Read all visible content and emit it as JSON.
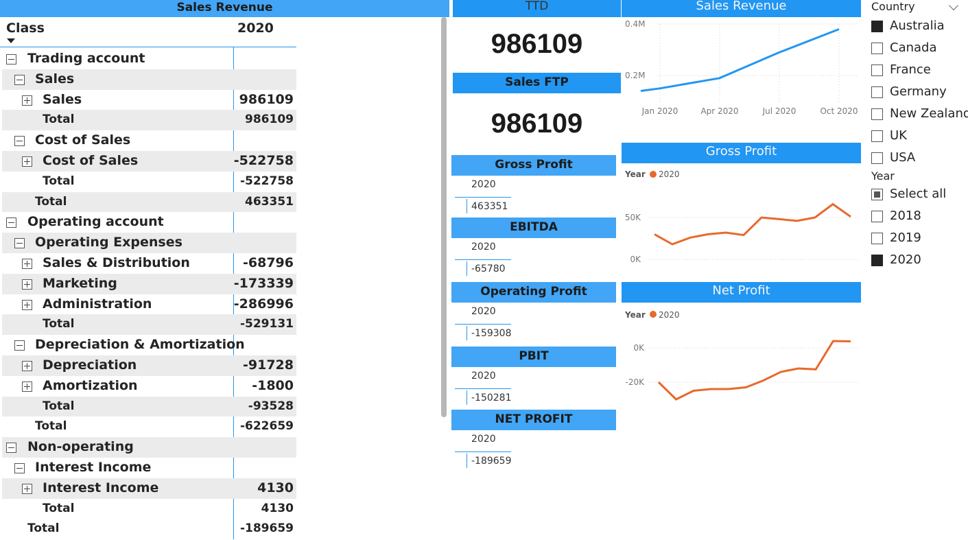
{
  "matrix": {
    "title": "Sales Revenue",
    "header_class": "Class",
    "header_year": "2020",
    "rows": [
      {
        "label": "Trading account",
        "value": "",
        "level": 0,
        "toggle": "minus",
        "shade": false,
        "total": false
      },
      {
        "label": "Sales",
        "value": "",
        "level": 1,
        "toggle": "minus",
        "shade": true,
        "total": false
      },
      {
        "label": "Sales",
        "value": "986109",
        "level": 2,
        "toggle": "plus",
        "shade": false,
        "total": false
      },
      {
        "label": "Total",
        "value": "986109",
        "level": 2,
        "toggle": "",
        "shade": true,
        "total": true
      },
      {
        "label": "Cost of Sales",
        "value": "",
        "level": 1,
        "toggle": "minus",
        "shade": false,
        "total": false
      },
      {
        "label": "Cost of Sales",
        "value": "-522758",
        "level": 2,
        "toggle": "plus",
        "shade": true,
        "total": false
      },
      {
        "label": "Total",
        "value": "-522758",
        "level": 2,
        "toggle": "",
        "shade": false,
        "total": true
      },
      {
        "label": "Total",
        "value": "463351",
        "level": 1,
        "toggle": "",
        "shade": true,
        "total": true
      },
      {
        "label": "Operating account",
        "value": "",
        "level": 0,
        "toggle": "minus",
        "shade": false,
        "total": false
      },
      {
        "label": "Operating Expenses",
        "value": "",
        "level": 1,
        "toggle": "minus",
        "shade": true,
        "total": false
      },
      {
        "label": "Sales & Distribution",
        "value": "-68796",
        "level": 2,
        "toggle": "plus",
        "shade": false,
        "total": false
      },
      {
        "label": "Marketing",
        "value": "-173339",
        "level": 2,
        "toggle": "plus",
        "shade": true,
        "total": false
      },
      {
        "label": "Administration",
        "value": "-286996",
        "level": 2,
        "toggle": "plus",
        "shade": false,
        "total": false
      },
      {
        "label": "Total",
        "value": "-529131",
        "level": 2,
        "toggle": "",
        "shade": true,
        "total": true
      },
      {
        "label": "Depreciation & Amortization",
        "value": "",
        "level": 1,
        "toggle": "minus",
        "shade": false,
        "total": false
      },
      {
        "label": "Depreciation",
        "value": "-91728",
        "level": 2,
        "toggle": "plus",
        "shade": true,
        "total": false
      },
      {
        "label": "Amortization",
        "value": "-1800",
        "level": 2,
        "toggle": "plus",
        "shade": false,
        "total": false
      },
      {
        "label": "Total",
        "value": "-93528",
        "level": 2,
        "toggle": "",
        "shade": true,
        "total": true
      },
      {
        "label": "Total",
        "value": "-622659",
        "level": 1,
        "toggle": "",
        "shade": false,
        "total": true
      },
      {
        "label": "Non-operating",
        "value": "",
        "level": 0,
        "toggle": "minus",
        "shade": true,
        "total": false
      },
      {
        "label": "Interest Income",
        "value": "",
        "level": 1,
        "toggle": "minus",
        "shade": false,
        "total": false
      },
      {
        "label": "Interest Income",
        "value": "4130",
        "level": 2,
        "toggle": "plus",
        "shade": true,
        "total": false
      },
      {
        "label": "Total",
        "value": "4130",
        "level": 2,
        "toggle": "",
        "shade": false,
        "total": true
      },
      {
        "label": "Total",
        "value": "-189659",
        "level": 0,
        "toggle": "",
        "shade": false,
        "total": true
      }
    ]
  },
  "kpis": {
    "ttd_title": "TTD",
    "ttd_value": "986109",
    "ftp_title": "Sales FTP",
    "ftp_value": "986109"
  },
  "cards": [
    {
      "title": "Gross Profit",
      "year": "2020",
      "value": "463351"
    },
    {
      "title": "EBITDA",
      "year": "2020",
      "value": "-65780"
    },
    {
      "title": "Operating Profit",
      "year": "2020",
      "value": "-159308"
    },
    {
      "title": "PBIT",
      "year": "2020",
      "value": "-150281"
    },
    {
      "title": "NET PROFIT",
      "year": "2020",
      "value": "-189659"
    }
  ],
  "chart_data": [
    {
      "type": "line",
      "title": "Sales Revenue",
      "x": [
        "Jan 2020",
        "Apr 2020",
        "Jul 2020",
        "Oct 2020"
      ],
      "x_ticks": [
        "Jan 2020",
        "Apr 2020",
        "Jul 2020",
        "Oct 2020"
      ],
      "y_ticks": [
        "0.4M",
        "0.2M"
      ],
      "series": [
        {
          "values": [
            140000,
            190000,
            290000,
            380000
          ]
        }
      ],
      "color": "#2196f3",
      "grid": true
    },
    {
      "type": "line",
      "title": "Gross Profit",
      "legend_title": "Year",
      "y_ticks": [
        "50K",
        "0K"
      ],
      "series": [
        {
          "name": "2020",
          "values": [
            30000,
            18000,
            26000,
            30000,
            32000,
            29000,
            50000,
            48000,
            46000,
            50000,
            66000,
            51000
          ]
        }
      ],
      "color": "#e8692c",
      "grid": true
    },
    {
      "type": "line",
      "title": "Net Profit",
      "legend_title": "Year",
      "y_ticks": [
        "0K",
        "-20K"
      ],
      "series": [
        {
          "name": "2020",
          "values": [
            -20000,
            -30000,
            -25000,
            -24000,
            -24000,
            -23000,
            -19000,
            -14000,
            -12000,
            -12500,
            4000,
            3800
          ]
        }
      ],
      "color": "#e8692c",
      "grid": true
    }
  ],
  "slicers": {
    "country_title": "Country",
    "countries": [
      {
        "label": "Australia",
        "state": "on"
      },
      {
        "label": "Canada",
        "state": "off"
      },
      {
        "label": "France",
        "state": "off"
      },
      {
        "label": "Germany",
        "state": "off"
      },
      {
        "label": "New Zealand",
        "state": "off"
      },
      {
        "label": "UK",
        "state": "off"
      },
      {
        "label": "USA",
        "state": "off"
      }
    ],
    "year_title": "Year",
    "years": [
      {
        "label": "Select all",
        "state": "partial"
      },
      {
        "label": "2018",
        "state": "off"
      },
      {
        "label": "2019",
        "state": "off"
      },
      {
        "label": "2020",
        "state": "on"
      }
    ]
  }
}
